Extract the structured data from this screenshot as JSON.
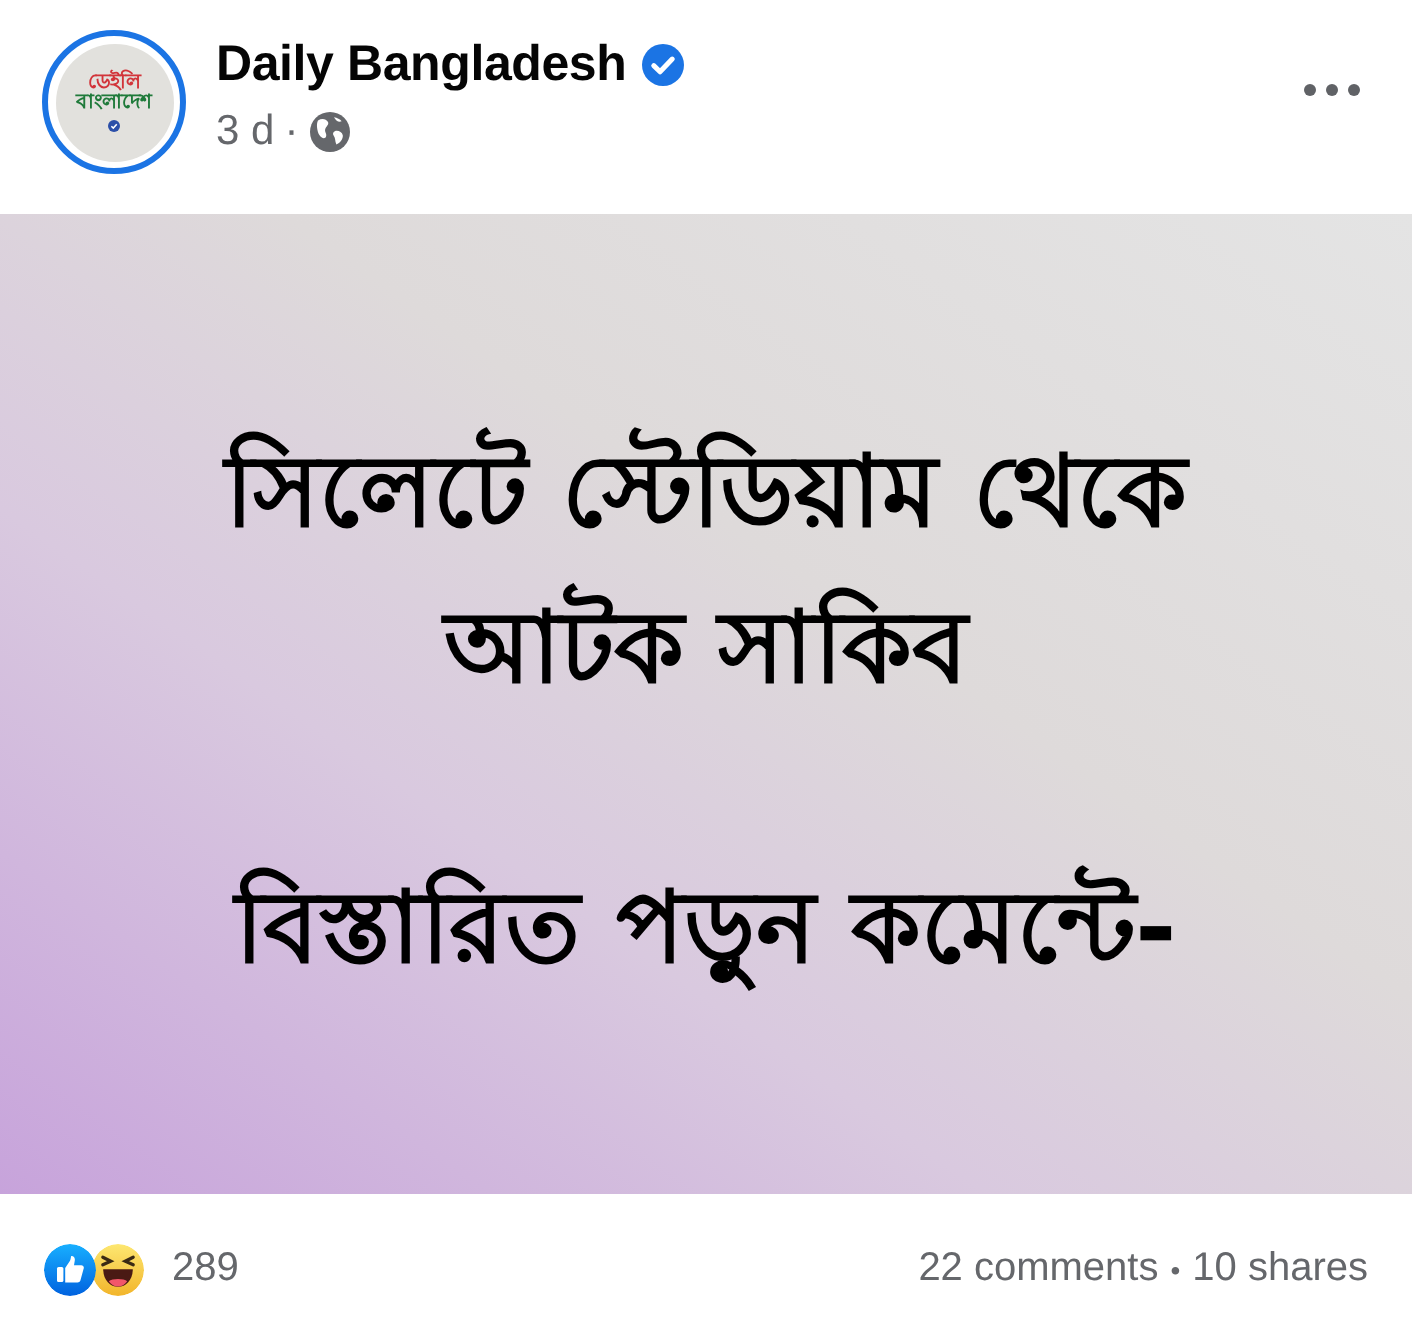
{
  "post": {
    "author": "Daily Bangladesh",
    "verified": true,
    "time": "3 d",
    "time_separator": "·",
    "avatar": {
      "logo_lines": [
        "ডেইলি",
        "বাংলাদেশ"
      ]
    }
  },
  "image": {
    "headline": "সিলেটে স্টেডিয়াম থেকে আটক সাকিব",
    "cta": "বিস্তারিত পড়ুন কমেন্টে-"
  },
  "footer": {
    "reaction_count": "289",
    "comments": "22 comments",
    "separator": "•",
    "shares": "10 shares"
  }
}
